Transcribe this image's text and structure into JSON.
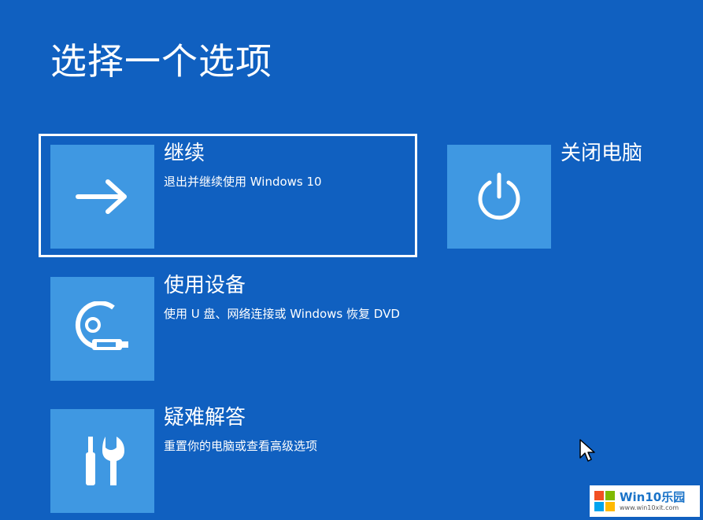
{
  "page": {
    "title": "选择一个选项"
  },
  "options": [
    {
      "label": "继续",
      "description": "退出并继续使用 Windows 10",
      "icon": "arrow-right-icon"
    },
    {
      "label": "使用设备",
      "description": "使用 U 盘、网络连接或 Windows 恢复 DVD",
      "icon": "disc-usb-icon"
    },
    {
      "label": "疑难解答",
      "description": "重置你的电脑或查看高级选项",
      "icon": "tools-icon"
    },
    {
      "label": "关闭电脑",
      "description": "",
      "icon": "power-icon"
    }
  ],
  "colors": {
    "background": "#1060c0",
    "tile": "#3f98e2",
    "text": "#ffffff"
  },
  "watermark": {
    "title": "Win10乐园",
    "url": "www.win10xit.com"
  }
}
